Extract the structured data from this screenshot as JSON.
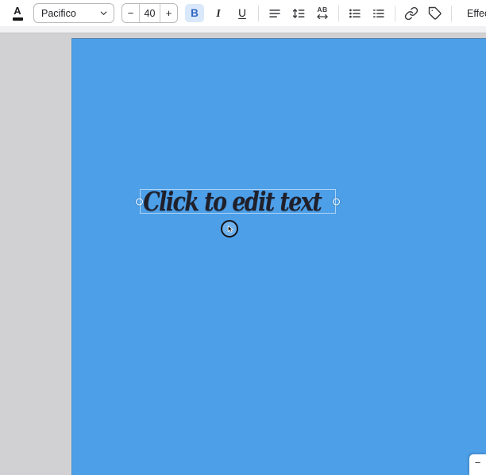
{
  "toolbar": {
    "font_color_glyph": "A",
    "font_family_selected": "Pacifico",
    "font_size_value": "40",
    "decrease_label": "−",
    "increase_label": "+",
    "bold_label": "B",
    "italic_label": "I",
    "underline_label": "U",
    "letter_spacing_label": "AB",
    "effects_label": "Effects",
    "overflow_menu_glyph": "⋮"
  },
  "canvas": {
    "text": "Click to edit text"
  },
  "zoom_control": {
    "zoom_out_label": "−"
  },
  "icons": {
    "font_color": "letter A over black color swatch",
    "chevron_down": "⌄",
    "align_text": "≡ horizontal lines",
    "line_spacing": "↕ with lines",
    "letter_spacing": "AB over ↔",
    "bullet_list": "• dotted list",
    "numbered_list": "ordered list",
    "link": "chain link",
    "tag": "price tag",
    "kebab_menu": "⋮",
    "cursor": "pointer arrow inside click ring",
    "selection_handle": "○ white circle"
  },
  "colors": {
    "canvas_background": "#4d9fe8",
    "canvas_text": "#20202b",
    "toolbar_background": "#ffffff",
    "bold_active_background": "#d9e8fa",
    "bold_active_text": "#3168c4",
    "workspace_background": "#d1d1d3",
    "selection_outline": "rgba(255,255,255,0.55)"
  }
}
